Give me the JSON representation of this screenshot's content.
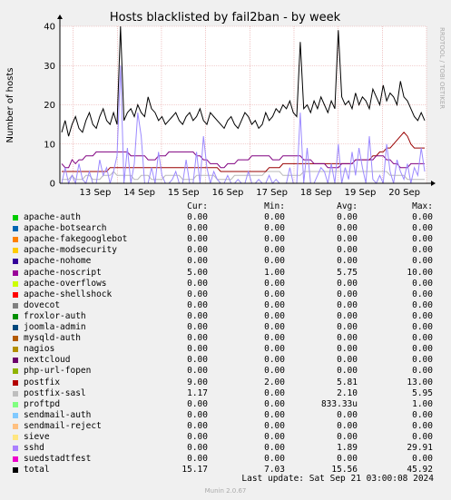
{
  "chart_data": {
    "type": "line",
    "title": "Hosts blacklisted by fail2ban - by week",
    "ylabel": "Number of hosts",
    "xlabel": "",
    "ylim": [
      0,
      40
    ],
    "yticks": [
      0,
      10,
      20,
      30,
      40
    ],
    "xticks": [
      "13 Sep",
      "14 Sep",
      "15 Sep",
      "16 Sep",
      "17 Sep",
      "18 Sep",
      "19 Sep",
      "20 Sep"
    ],
    "grid": true,
    "watermark": "RRDTOOL / TOBI OETIKER",
    "series": [
      {
        "name": "total",
        "color": "#000000",
        "values": [
          13,
          16,
          12,
          15,
          17,
          14,
          13,
          16,
          18,
          15,
          14,
          17,
          19,
          16,
          15,
          18,
          15,
          40,
          16,
          18,
          19,
          17,
          20,
          18,
          17,
          22,
          19,
          18,
          16,
          17,
          15,
          16,
          17,
          18,
          16,
          15,
          17,
          18,
          16,
          17,
          19,
          16,
          15,
          18,
          17,
          16,
          15,
          14,
          16,
          17,
          15,
          14,
          16,
          18,
          17,
          15,
          16,
          14,
          15,
          18,
          16,
          17,
          19,
          18,
          20,
          19,
          21,
          18,
          17,
          36,
          19,
          20,
          18,
          21,
          19,
          22,
          20,
          18,
          21,
          19,
          39,
          22,
          20,
          21,
          19,
          23,
          20,
          22,
          21,
          19,
          24,
          22,
          20,
          25,
          21,
          23,
          22,
          20,
          26,
          22,
          21,
          19,
          17,
          16,
          18,
          16
        ]
      },
      {
        "name": "sshd",
        "color": "#9c8aff",
        "values": [
          0,
          4,
          0,
          2,
          0,
          5,
          1,
          0,
          3,
          0,
          0,
          6,
          2,
          4,
          0,
          3,
          7,
          30,
          0,
          9,
          0,
          5,
          18,
          12,
          0,
          0,
          4,
          0,
          8,
          2,
          0,
          0,
          1,
          3,
          0,
          0,
          6,
          0,
          0,
          8,
          0,
          12,
          4,
          0,
          3,
          1,
          0,
          0,
          2,
          0,
          0,
          1,
          0,
          0,
          3,
          0,
          0,
          1,
          0,
          0,
          2,
          0,
          1,
          0,
          0,
          0,
          4,
          0,
          0,
          18,
          0,
          9,
          0,
          0,
          2,
          4,
          3,
          0,
          5,
          0,
          10,
          0,
          4,
          1,
          8,
          2,
          9,
          4,
          0,
          12,
          1,
          0,
          2,
          0,
          10,
          3,
          0,
          6,
          3,
          1,
          5,
          0,
          4,
          2,
          9,
          3
        ]
      },
      {
        "name": "apache-noscript",
        "color": "#800080",
        "values": [
          5,
          4,
          4,
          6,
          5,
          6,
          6,
          7,
          7,
          7,
          8,
          8,
          8,
          8,
          8,
          8,
          8,
          8,
          8,
          8,
          7,
          7,
          7,
          7,
          7,
          6,
          6,
          6,
          7,
          7,
          7,
          8,
          8,
          8,
          8,
          8,
          8,
          8,
          8,
          7,
          7,
          6,
          6,
          5,
          5,
          5,
          4,
          4,
          5,
          5,
          5,
          6,
          6,
          6,
          6,
          7,
          7,
          7,
          7,
          7,
          7,
          6,
          6,
          6,
          7,
          7,
          7,
          7,
          7,
          7,
          6,
          6,
          6,
          5,
          5,
          5,
          5,
          4,
          4,
          4,
          4,
          5,
          5,
          5,
          5,
          6,
          6,
          6,
          6,
          6,
          6,
          7,
          7,
          7,
          6,
          6,
          5,
          5,
          4,
          4,
          4,
          5,
          5,
          5,
          5,
          5
        ]
      },
      {
        "name": "postfix",
        "color": "#990000",
        "values": [
          3,
          3,
          3,
          3,
          3,
          3,
          3,
          3,
          3,
          3,
          3,
          3,
          3,
          3,
          4,
          4,
          4,
          4,
          4,
          4,
          4,
          4,
          4,
          4,
          4,
          4,
          4,
          4,
          4,
          4,
          4,
          4,
          4,
          4,
          4,
          4,
          4,
          4,
          4,
          4,
          4,
          4,
          4,
          4,
          4,
          4,
          3,
          3,
          3,
          3,
          3,
          3,
          3,
          3,
          3,
          3,
          3,
          3,
          3,
          3,
          4,
          4,
          4,
          4,
          5,
          5,
          5,
          5,
          5,
          5,
          5,
          5,
          5,
          5,
          5,
          5,
          5,
          5,
          5,
          5,
          5,
          5,
          5,
          5,
          5,
          6,
          6,
          6,
          6,
          6,
          7,
          7,
          8,
          8,
          9,
          9,
          10,
          11,
          12,
          13,
          12,
          10,
          9,
          9,
          9,
          9
        ]
      },
      {
        "name": "postfix-sasl",
        "color": "#b8b8b8",
        "values": [
          1,
          1,
          1,
          2,
          1,
          1,
          1,
          2,
          2,
          1,
          1,
          1,
          2,
          2,
          2,
          3,
          2,
          2,
          2,
          2,
          2,
          1,
          1,
          2,
          2,
          2,
          1,
          1,
          1,
          1,
          2,
          2,
          2,
          2,
          2,
          1,
          1,
          1,
          1,
          2,
          2,
          2,
          2,
          2,
          2,
          1,
          1,
          1,
          1,
          1,
          2,
          2,
          2,
          2,
          2,
          2,
          2,
          2,
          2,
          3,
          3,
          3,
          3,
          3,
          2,
          2,
          2,
          2,
          2,
          2,
          3,
          3,
          3,
          3,
          3,
          3,
          3,
          3,
          3,
          3,
          3,
          3,
          3,
          3,
          3,
          3,
          3,
          3,
          3,
          3,
          3,
          3,
          3,
          3,
          3,
          2,
          2,
          2,
          2,
          2,
          1,
          1,
          1,
          1,
          1,
          1
        ]
      }
    ],
    "legend_headers": {
      "cur": "Cur:",
      "min": "Min:",
      "avg": "Avg:",
      "max": "Max:"
    },
    "legend": [
      {
        "name": "apache-auth",
        "color": "#00cc00",
        "cur": "0.00",
        "min": "0.00",
        "avg": "0.00",
        "max": "0.00"
      },
      {
        "name": "apache-botsearch",
        "color": "#0066b3",
        "cur": "0.00",
        "min": "0.00",
        "avg": "0.00",
        "max": "0.00"
      },
      {
        "name": "apache-fakegooglebot",
        "color": "#ff8000",
        "cur": "0.00",
        "min": "0.00",
        "avg": "0.00",
        "max": "0.00"
      },
      {
        "name": "apache-modsecurity",
        "color": "#ffcc00",
        "cur": "0.00",
        "min": "0.00",
        "avg": "0.00",
        "max": "0.00"
      },
      {
        "name": "apache-nohome",
        "color": "#330099",
        "cur": "0.00",
        "min": "0.00",
        "avg": "0.00",
        "max": "0.00"
      },
      {
        "name": "apache-noscript",
        "color": "#990099",
        "cur": "5.00",
        "min": "1.00",
        "avg": "5.75",
        "max": "10.00"
      },
      {
        "name": "apache-overflows",
        "color": "#ccff00",
        "cur": "0.00",
        "min": "0.00",
        "avg": "0.00",
        "max": "0.00"
      },
      {
        "name": "apache-shellshock",
        "color": "#ff0000",
        "cur": "0.00",
        "min": "0.00",
        "avg": "0.00",
        "max": "0.00"
      },
      {
        "name": "dovecot",
        "color": "#808080",
        "cur": "0.00",
        "min": "0.00",
        "avg": "0.00",
        "max": "0.00"
      },
      {
        "name": "froxlor-auth",
        "color": "#008f00",
        "cur": "0.00",
        "min": "0.00",
        "avg": "0.00",
        "max": "0.00"
      },
      {
        "name": "joomla-admin",
        "color": "#00487d",
        "cur": "0.00",
        "min": "0.00",
        "avg": "0.00",
        "max": "0.00"
      },
      {
        "name": "mysqld-auth",
        "color": "#b35a00",
        "cur": "0.00",
        "min": "0.00",
        "avg": "0.00",
        "max": "0.00"
      },
      {
        "name": "nagios",
        "color": "#b38f00",
        "cur": "0.00",
        "min": "0.00",
        "avg": "0.00",
        "max": "0.00"
      },
      {
        "name": "nextcloud",
        "color": "#6b006b",
        "cur": "0.00",
        "min": "0.00",
        "avg": "0.00",
        "max": "0.00"
      },
      {
        "name": "php-url-fopen",
        "color": "#8fb300",
        "cur": "0.00",
        "min": "0.00",
        "avg": "0.00",
        "max": "0.00"
      },
      {
        "name": "postfix",
        "color": "#b30000",
        "cur": "9.00",
        "min": "2.00",
        "avg": "5.81",
        "max": "13.00"
      },
      {
        "name": "postfix-sasl",
        "color": "#bebebe",
        "cur": "1.17",
        "min": "0.00",
        "avg": "2.10",
        "max": "5.95"
      },
      {
        "name": "proftpd",
        "color": "#80ff80",
        "cur": "0.00",
        "min": "0.00",
        "avg": "833.33u",
        "max": "1.00"
      },
      {
        "name": "sendmail-auth",
        "color": "#80c9ff",
        "cur": "0.00",
        "min": "0.00",
        "avg": "0.00",
        "max": "0.00"
      },
      {
        "name": "sendmail-reject",
        "color": "#ffc080",
        "cur": "0.00",
        "min": "0.00",
        "avg": "0.00",
        "max": "0.00"
      },
      {
        "name": "sieve",
        "color": "#ffe680",
        "cur": "0.00",
        "min": "0.00",
        "avg": "0.00",
        "max": "0.00"
      },
      {
        "name": "sshd",
        "color": "#aa80ff",
        "cur": "0.00",
        "min": "0.00",
        "avg": "1.89",
        "max": "29.91"
      },
      {
        "name": "suedstadtfest",
        "color": "#ee00cc",
        "cur": "0.00",
        "min": "0.00",
        "avg": "0.00",
        "max": "0.00"
      },
      {
        "name": "total",
        "color": "#000000",
        "cur": "15.17",
        "min": "7.03",
        "avg": "15.56",
        "max": "45.92"
      }
    ]
  },
  "footer": {
    "last_update": "Last update: Sat Sep 21 03:00:08 2024",
    "version": "Munin 2.0.67"
  }
}
